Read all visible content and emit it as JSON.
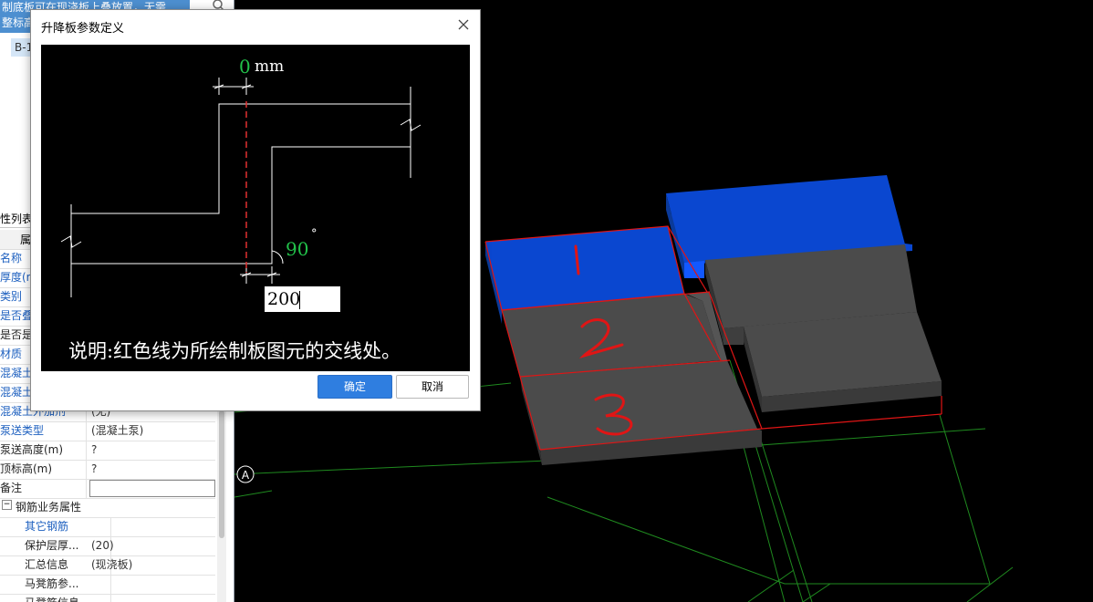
{
  "left_panel": {
    "banner_line1": "制底板可在现浇板上叠放置，无需",
    "banner_line2": "整标高",
    "tree_node": "B-1",
    "tab_label": "性列表",
    "header_col": "属",
    "rows": [
      {
        "name": "名称",
        "value": "",
        "color": "blue"
      },
      {
        "name": "厚度(m",
        "value": "",
        "color": "blue"
      },
      {
        "name": "类别",
        "value": "",
        "color": "blue"
      },
      {
        "name": "是否叠",
        "value": "",
        "color": "blue"
      },
      {
        "name": "是否是",
        "value": "",
        "color": "black"
      },
      {
        "name": "材质",
        "value": "",
        "color": "blue"
      },
      {
        "name": "混凝土",
        "value": "",
        "color": "blue"
      },
      {
        "name": "混凝土",
        "value": "",
        "color": "blue"
      },
      {
        "name": "混凝土外加剂",
        "value": "(无)",
        "color": "blue"
      },
      {
        "name": "泵送类型",
        "value": "(混凝土泵)",
        "color": "blue"
      },
      {
        "name": "泵送高度(m)",
        "value": "?",
        "color": "black"
      },
      {
        "name": "顶标高(m)",
        "value": "?",
        "color": "black"
      },
      {
        "name": "备注",
        "value": "",
        "color": "black"
      },
      {
        "name": "钢筋业务属性",
        "value": "",
        "color": "black",
        "group": true
      },
      {
        "name": "其它钢筋",
        "value": "",
        "color": "blue",
        "indent": true
      },
      {
        "name": "保护层厚...",
        "value": "(20)",
        "color": "black",
        "indent": true
      },
      {
        "name": "汇总信息",
        "value": "(现浇板)",
        "color": "black",
        "indent": true
      },
      {
        "name": "马凳筋参...",
        "value": "",
        "color": "black",
        "indent": true
      },
      {
        "name": "马凳筋信息",
        "value": "",
        "color": "black",
        "indent": true
      }
    ],
    "collapse_symbol": "−"
  },
  "scene": {
    "axis_label": "A",
    "slab_labels": [
      "1",
      "2",
      "3"
    ],
    "colors": {
      "selected": "#0a47d0",
      "slab": "#4b4b4b",
      "edge_red": "#e01515",
      "grid": "#1f8a1f"
    }
  },
  "dialog": {
    "title": "升降板参数定义",
    "offset_value": "0",
    "offset_unit": "mm",
    "angle_value": "90",
    "angle_unit": "°",
    "input_value": "200",
    "note": "说明:红色线为所绘制板图元的交线处。",
    "ok_label": "确定",
    "cancel_label": "取消"
  }
}
